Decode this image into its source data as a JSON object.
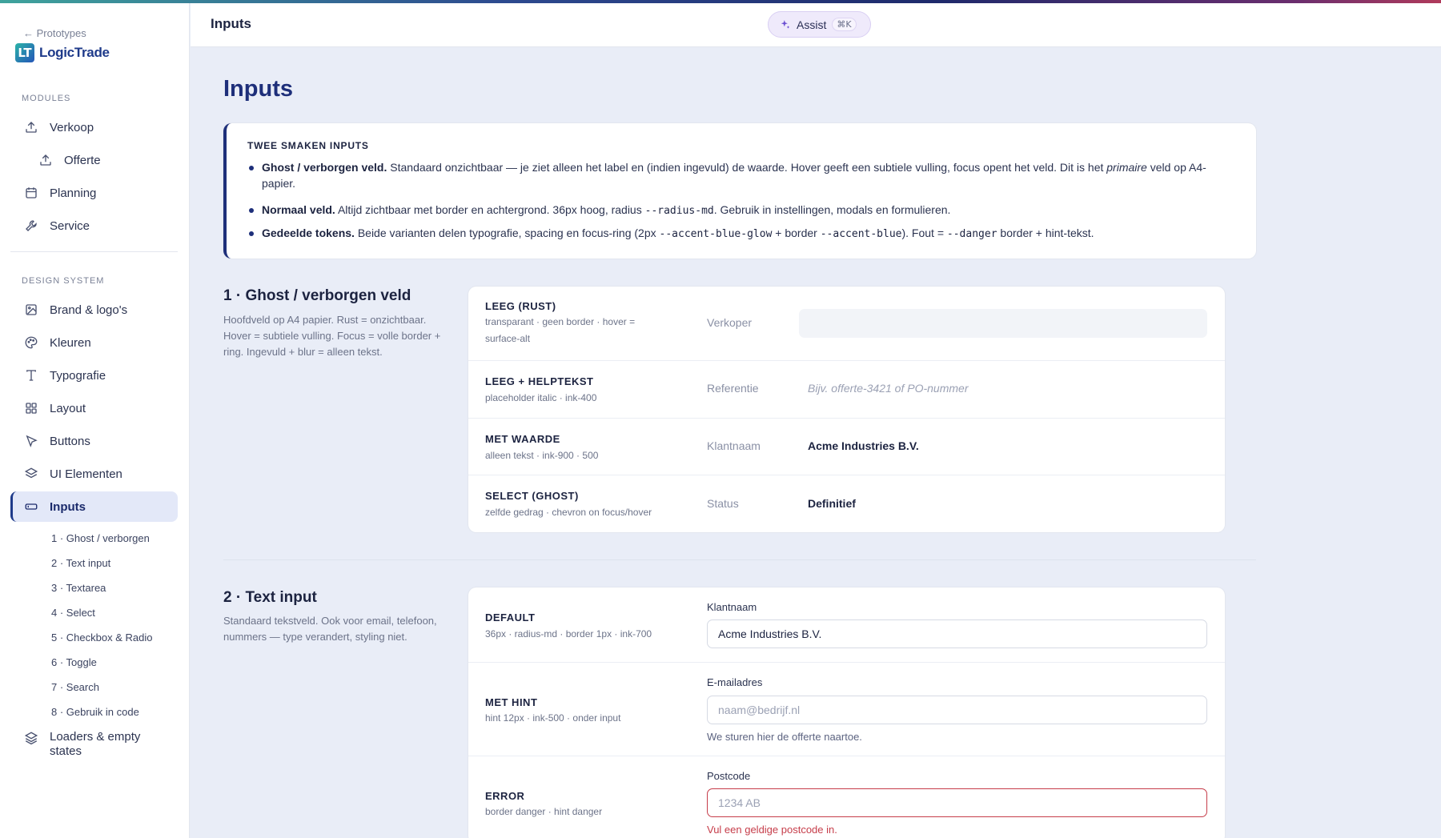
{
  "sidebar": {
    "back_link": "← Prototypes",
    "logo_mark": "LT",
    "logo_text": "LogicTrade",
    "modules_label": "MODULES",
    "modules": [
      {
        "label": "Verkoop",
        "icon": "upload-icon"
      },
      {
        "label": "Offerte",
        "icon": "upload-icon"
      },
      {
        "label": "Planning",
        "icon": "calendar-icon"
      },
      {
        "label": "Service",
        "icon": "wrench-icon"
      }
    ],
    "design_label": "DESIGN SYSTEM",
    "design_items": [
      {
        "label": "Brand & logo's",
        "icon": "image-icon"
      },
      {
        "label": "Kleuren",
        "icon": "palette-icon"
      },
      {
        "label": "Typografie",
        "icon": "type-icon"
      },
      {
        "label": "Layout",
        "icon": "grid-icon"
      },
      {
        "label": "Buttons",
        "icon": "pointer-icon"
      },
      {
        "label": "UI Elementen",
        "icon": "layers-icon"
      },
      {
        "label": "Inputs",
        "icon": "input-icon"
      }
    ],
    "input_subnav": [
      "1 · Ghost / verborgen",
      "2 · Text input",
      "3 · Textarea",
      "4 · Select",
      "5 · Checkbox & Radio",
      "6 · Toggle",
      "7 · Search",
      "8 · Gebruik in code"
    ],
    "loaders_label": "Loaders & empty states"
  },
  "header": {
    "title": "Inputs",
    "assist_label": "Assist",
    "assist_shortcut": "⌘K"
  },
  "main": {
    "title": "Inputs",
    "info": {
      "title": "TWEE SMAKEN INPUTS",
      "b1_strong": "Ghost / verborgen veld.",
      "b1_text": " Standaard onzichtbaar — je ziet alleen het label en (indien ingevuld) de waarde. Hover geeft een subtiele vulling, focus opent het veld. Dit is het ",
      "b1_em": "primaire",
      "b1_tail": " veld op A4-papier.",
      "b2_strong": "Normaal veld.",
      "b2_text": " Altijd zichtbaar met border en achtergrond. 36px hoog, radius ",
      "b2_code": "--radius-md",
      "b2_tail": ". Gebruik in instellingen, modals en formulieren.",
      "b3_strong": "Gedeelde tokens.",
      "b3_text1": " Beide varianten delen typografie, spacing en focus-ring (2px ",
      "b3_code1": "--accent-blue-glow",
      "b3_text2": " + border ",
      "b3_code2": "--accent-blue",
      "b3_text3": "). Fout = ",
      "b3_code3": "--danger",
      "b3_text4": " border + hint-tekst."
    },
    "section1": {
      "title": "1 · Ghost / verborgen veld",
      "desc": "Hoofdveld op A4 papier. Rust = onzichtbaar. Hover = subtiele vulling. Focus = volle border + ring. Ingevuld + blur = alleen tekst.",
      "rows": [
        {
          "title": "LEEG (RUST)",
          "meta": "transparant · geen border · hover = surface-alt",
          "label": "Verkoper",
          "value": ""
        },
        {
          "title": "LEEG + HELPTEKST",
          "meta": "placeholder italic · ink-400",
          "label": "Referentie",
          "placeholder": "Bijv. offerte-3421 of PO-nummer"
        },
        {
          "title": "MET WAARDE",
          "meta": "alleen tekst · ink-900 · 500",
          "label": "Klantnaam",
          "value": "Acme Industries B.V."
        },
        {
          "title": "SELECT (GHOST)",
          "meta": "zelfde gedrag · chevron on focus/hover",
          "label": "Status",
          "value": "Definitief"
        }
      ]
    },
    "section2": {
      "title": "2 · Text input",
      "desc": "Standaard tekstveld. Ook voor email, telefoon, nummers — type verandert, styling niet.",
      "rows": [
        {
          "title": "DEFAULT",
          "meta": "36px · radius-md · border 1px · ink-700",
          "label": "Klantnaam",
          "value": "Acme Industries B.V."
        },
        {
          "title": "MET HINT",
          "meta": "hint 12px · ink-500 · onder input",
          "label": "E-mailadres",
          "placeholder": "naam@bedrijf.nl",
          "hint": "We sturen hier de offerte naartoe."
        },
        {
          "title": "ERROR",
          "meta": "border danger · hint danger",
          "label": "Postcode",
          "placeholder": "1234 AB",
          "hint": "Vul een geldige postcode in."
        }
      ]
    }
  },
  "colors": {
    "accent": "#1e2f7a",
    "danger": "#c63d4a",
    "background": "#e9edf7"
  }
}
